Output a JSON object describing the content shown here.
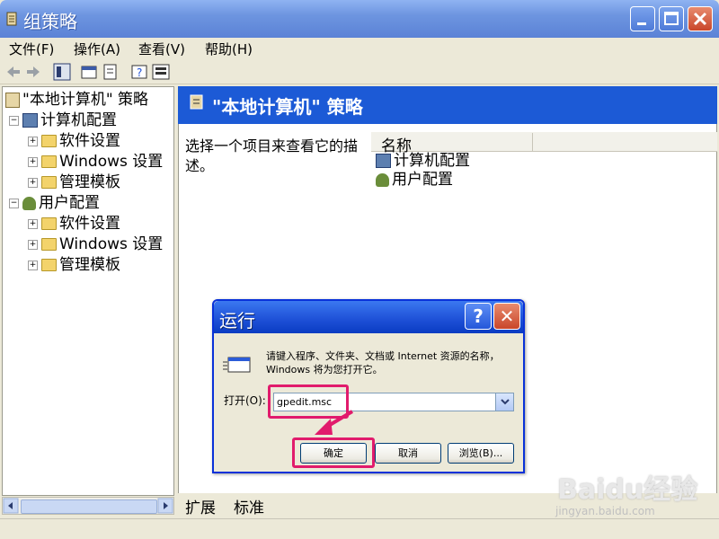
{
  "window": {
    "title": "组策略"
  },
  "menu": [
    "文件(F)",
    "操作(A)",
    "查看(V)",
    "帮助(H)"
  ],
  "tree": {
    "root": "\"本地计算机\" 策略",
    "computer": "计算机配置",
    "user": "用户配置",
    "children": [
      "软件设置",
      "Windows 设置",
      "管理模板"
    ]
  },
  "right": {
    "header": "\"本地计算机\" 策略",
    "description": "选择一个项目来查看它的描述。",
    "column_name": "名称",
    "items": [
      "计算机配置",
      "用户配置"
    ]
  },
  "tabs": [
    "扩展",
    "标准"
  ],
  "dialog": {
    "title": "运行",
    "help_glyph": "?",
    "close_glyph": "✕",
    "message": "请键入程序、文件夹、文档或 Internet 资源的名称，Windows 将为您打开它。",
    "open_label": "打开(O):",
    "input_value": "gpedit.msc",
    "ok": "确定",
    "cancel": "取消",
    "browse": "浏览(B)..."
  },
  "watermark": {
    "main": "Baidu经验",
    "sub": "jingyan.baidu.com"
  },
  "colors": {
    "highlight": "#e11b6c",
    "header_blue": "#1c5ad6"
  }
}
